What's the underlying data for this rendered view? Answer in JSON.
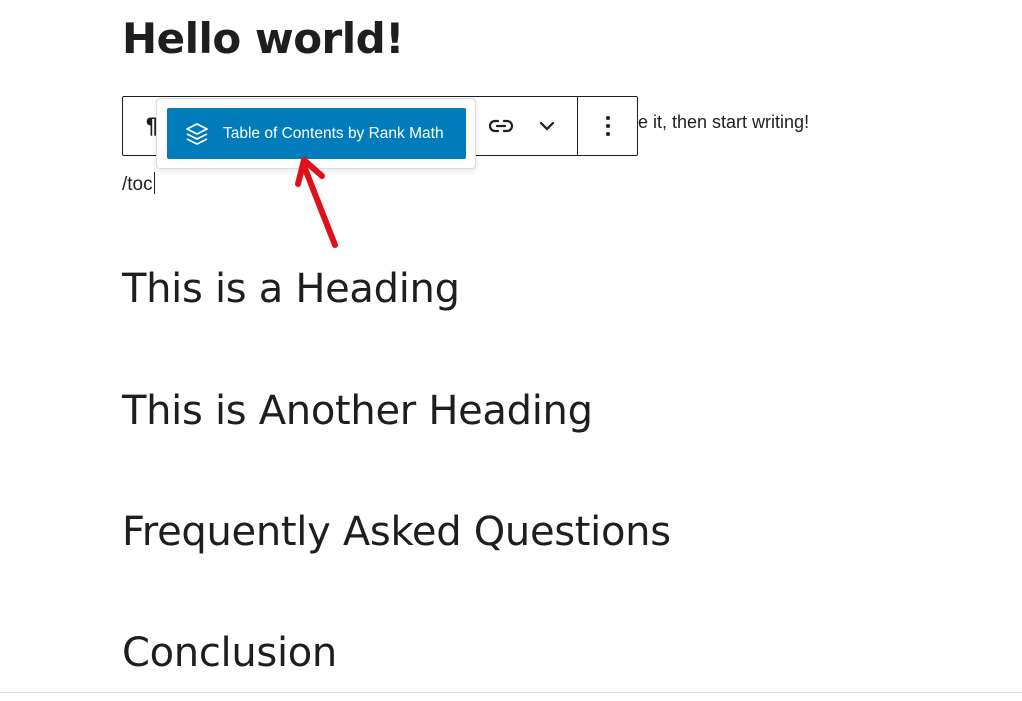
{
  "post": {
    "title": "Hello world!",
    "paragraph_tail": "e it, then start writing!",
    "slash_command": "/toc"
  },
  "toolbar": {
    "paragraph_icon": "¶",
    "buttons": [
      "paragraph-icon",
      "link-icon",
      "chevron-down-icon",
      "more-vertical-icon"
    ]
  },
  "autocomplete": {
    "suggestion_label": "Table of Contents by Rank Math",
    "suggestion_icon": "layers-icon"
  },
  "headings": [
    "This is a Heading",
    "This is Another Heading",
    "Frequently Asked Questions",
    "Conclusion"
  ],
  "colors": {
    "accent": "#007cba",
    "arrow": "#e0101a",
    "text": "#1e1e1e"
  }
}
